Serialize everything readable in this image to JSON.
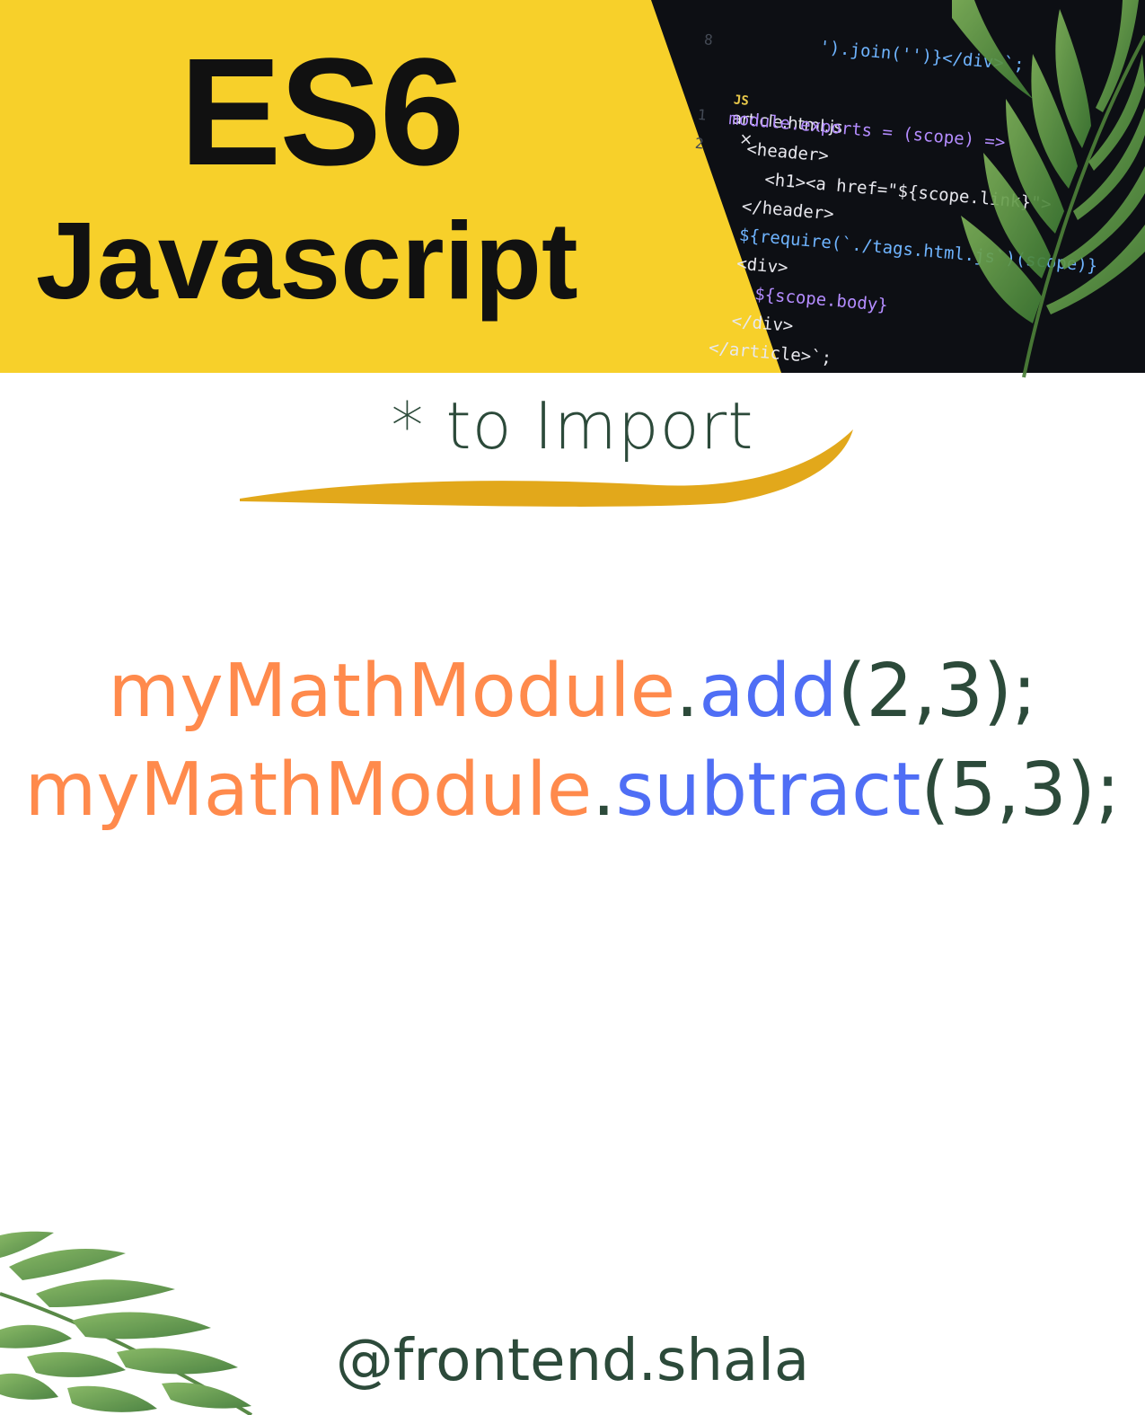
{
  "banner": {
    "title_line1": "ES6",
    "title_line2": "Javascript",
    "editor": {
      "top_line": "').join('')}</div>`;",
      "top_gutter": "8",
      "tab_icon": "JS",
      "tab_name": "article.html.js",
      "tab_close": "×",
      "gutter": [
        "1",
        "2"
      ],
      "lines": [
        "module.exports = (scope) =>",
        "  <header>",
        "    <h1><a href=\"${scope.link}\">",
        "  </header>",
        "  ${require(`./tags.html.js`)(scope)}",
        "  <div>",
        "    ${scope.body}",
        "  </div>",
        "</article>`;"
      ]
    }
  },
  "subtitle": "* to Import",
  "code": {
    "line1": {
      "object": "myMathModule",
      "dot": ".",
      "method": "add",
      "args": "(2,3);"
    },
    "line2": {
      "object": "myMathModule",
      "dot": ".",
      "method": "subtract",
      "args": "(5,3);"
    }
  },
  "handle": "@frontend.shala",
  "colors": {
    "banner_yellow": "#f7d02a",
    "editor_bg": "#0d0f14",
    "object_orange": "#ff8a4c",
    "method_blue": "#4f6ef5",
    "text_green": "#2c4a3a",
    "underline_gold": "#e2a81b",
    "leaf_green": "#5f9a48"
  },
  "icons": [
    "palm-leaf-icon",
    "brush-underline-icon",
    "close-icon",
    "js-file-icon"
  ]
}
